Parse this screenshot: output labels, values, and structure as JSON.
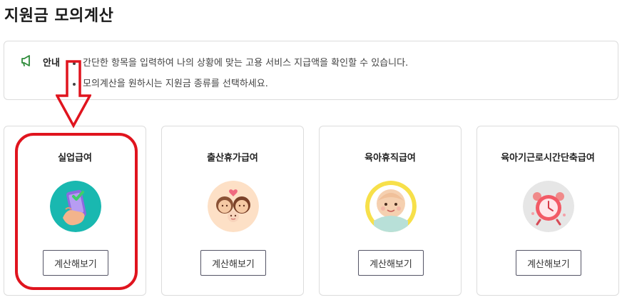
{
  "page": {
    "title": "지원금 모의계산"
  },
  "notice": {
    "label": "안내",
    "icon": "megaphone-icon",
    "items": [
      "간단한 항목을 입력하여 나의 상황에 맞는 고용 서비스 지급액을 확인할 수 있습니다.",
      "모의계산을 원하시는 지원금 종류를 선택하세요."
    ]
  },
  "cards": [
    {
      "title": "실업급여",
      "button_label": "계산해보기",
      "icon": "phone-check-icon"
    },
    {
      "title": "출산휴가급여",
      "button_label": "계산해보기",
      "icon": "family-icon"
    },
    {
      "title": "육아휴직급여",
      "button_label": "계산해보기",
      "icon": "baby-icon"
    },
    {
      "title": "육아기근로시간단축급여",
      "button_label": "계산해보기",
      "icon": "alarm-clock-icon"
    }
  ],
  "colors": {
    "highlight": "#e0141e",
    "notice_icon": "#2e8b3a"
  }
}
